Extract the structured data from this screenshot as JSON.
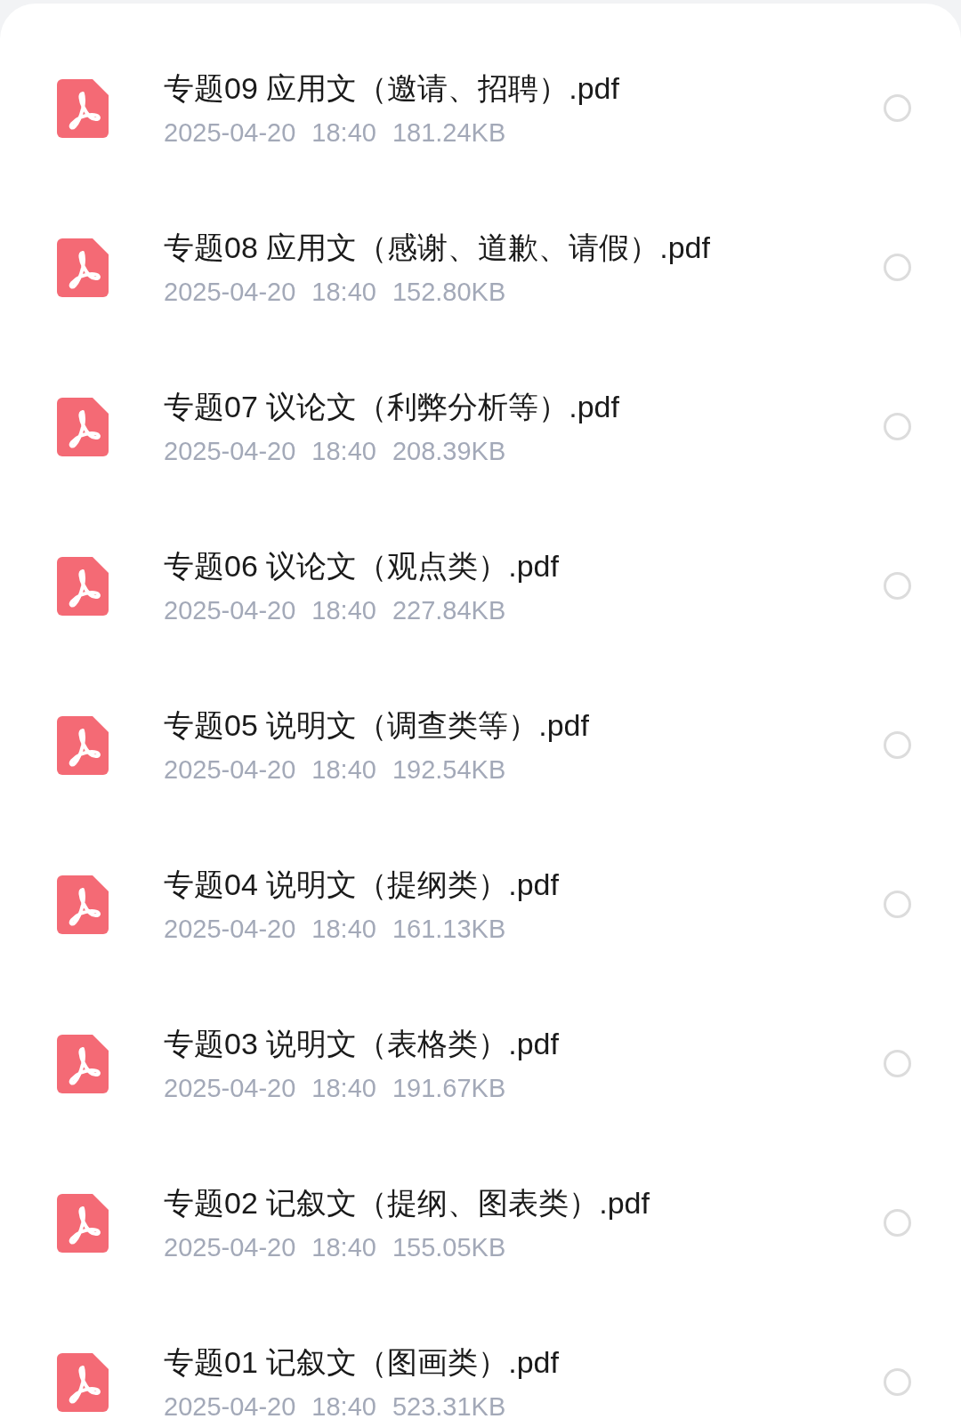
{
  "files": [
    {
      "name": "专题09 应用文（邀请、招聘）.pdf",
      "date": "2025-04-20",
      "time": "18:40",
      "size": "181.24KB",
      "selected": false
    },
    {
      "name": "专题08 应用文（感谢、道歉、请假）.pdf",
      "date": "2025-04-20",
      "time": "18:40",
      "size": "152.80KB",
      "selected": false
    },
    {
      "name": "专题07 议论文（利弊分析等）.pdf",
      "date": "2025-04-20",
      "time": "18:40",
      "size": "208.39KB",
      "selected": false
    },
    {
      "name": "专题06 议论文（观点类）.pdf",
      "date": "2025-04-20",
      "time": "18:40",
      "size": "227.84KB",
      "selected": false
    },
    {
      "name": "专题05 说明文（调查类等）.pdf",
      "date": "2025-04-20",
      "time": "18:40",
      "size": "192.54KB",
      "selected": false
    },
    {
      "name": "专题04 说明文（提纲类）.pdf",
      "date": "2025-04-20",
      "time": "18:40",
      "size": "161.13KB",
      "selected": false
    },
    {
      "name": "专题03 说明文（表格类）.pdf",
      "date": "2025-04-20",
      "time": "18:40",
      "size": "191.67KB",
      "selected": false
    },
    {
      "name": "专题02 记叙文（提纲、图表类）.pdf",
      "date": "2025-04-20",
      "time": "18:40",
      "size": "155.05KB",
      "selected": false
    },
    {
      "name": "专题01 记叙文（图画类）.pdf",
      "date": "2025-04-20",
      "time": "18:40",
      "size": "523.31KB",
      "selected": false
    }
  ]
}
